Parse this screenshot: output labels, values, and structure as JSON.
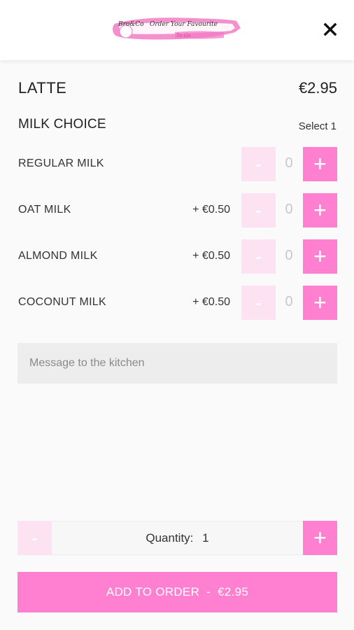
{
  "header": {
    "logo": {
      "brand": "Bro&Co",
      "tagline": "Order Your Favourite",
      "sub": "To Go"
    },
    "close_icon": "close-icon"
  },
  "product": {
    "name": "LATTE",
    "price": "€2.95"
  },
  "milk_section": {
    "title": "MILK CHOICE",
    "rule": "Select 1",
    "options": [
      {
        "label": "REGULAR MILK",
        "extra": "",
        "minus": "-",
        "quantity": "0",
        "plus": "+"
      },
      {
        "label": "OAT MILK",
        "extra": "+ €0.50",
        "minus": "-",
        "quantity": "0",
        "plus": "+"
      },
      {
        "label": "ALMOND MILK",
        "extra": "+ €0.50",
        "minus": "-",
        "quantity": "0",
        "plus": "+"
      },
      {
        "label": "COCONUT MILK",
        "extra": "+ €0.50",
        "minus": "-",
        "quantity": "0",
        "plus": "+"
      }
    ]
  },
  "message": {
    "placeholder": "Message to the kitchen",
    "value": ""
  },
  "quantity": {
    "minus": "-",
    "label": "Quantity:",
    "value": "1",
    "plus": "+"
  },
  "add_to_order": {
    "label": "ADD TO ORDER",
    "separator": "-",
    "total": "€2.95"
  },
  "colors": {
    "accent": "#ff7fd0",
    "accent_light": "#fde3f1",
    "background": "#fafafa"
  }
}
